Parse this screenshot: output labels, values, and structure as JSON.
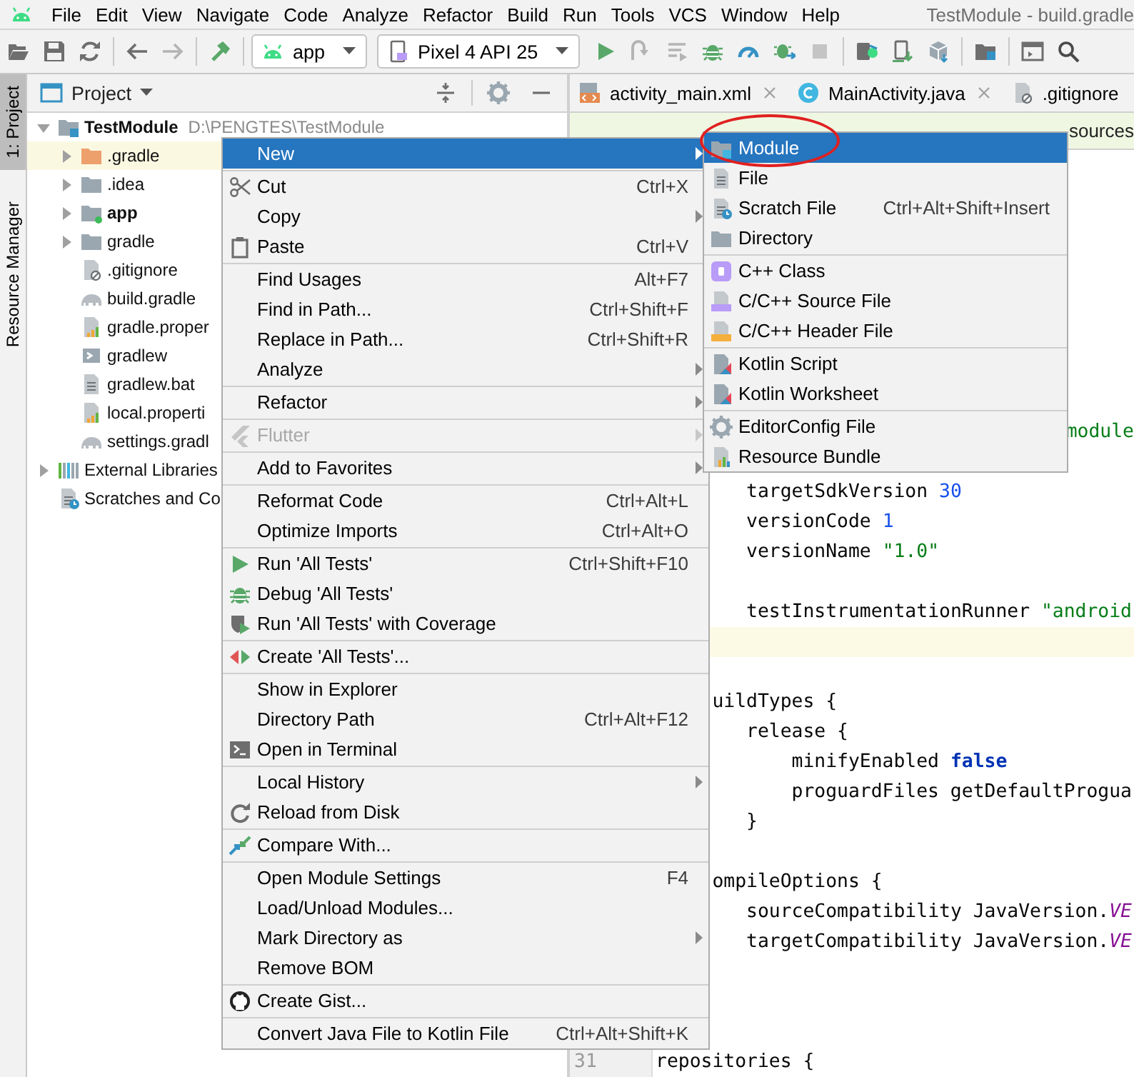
{
  "menu_bar": {
    "items": [
      "File",
      "Edit",
      "View",
      "Navigate",
      "Code",
      "Analyze",
      "Refactor",
      "Build",
      "Run",
      "Tools",
      "VCS",
      "Window",
      "Help"
    ],
    "title": "TestModule - build.gradle"
  },
  "toolbar": {
    "configuration": "app",
    "device": "Pixel 4 API 25"
  },
  "side_tabs": [
    {
      "label": "1: Project",
      "selected": true
    },
    {
      "label": "Resource Manager",
      "selected": false
    }
  ],
  "project_panel": {
    "title": "Project",
    "tree": [
      {
        "label": "TestModule",
        "path": "D:\\PENGTES\\TestModule",
        "kind": "project",
        "expanded": true,
        "children": [
          {
            "label": ".gradle",
            "kind": "folder",
            "expanded": false,
            "highlighted": true
          },
          {
            "label": ".idea",
            "kind": "folder",
            "expanded": false,
            "highlighted": false
          },
          {
            "label": "app",
            "kind": "module",
            "expanded": false,
            "highlighted": false
          },
          {
            "label": "gradle",
            "kind": "folder",
            "expanded": false,
            "highlighted": false
          },
          {
            "label": ".gitignore",
            "kind": "file",
            "highlighted": false
          },
          {
            "label": "build.gradle",
            "kind": "file",
            "highlighted": false
          },
          {
            "label": "gradle.proper",
            "kind": "file",
            "highlighted": false
          },
          {
            "label": "gradlew",
            "kind": "file",
            "highlighted": false
          },
          {
            "label": "gradlew.bat",
            "kind": "file",
            "highlighted": false
          },
          {
            "label": "local.properti",
            "kind": "file",
            "highlighted": false
          },
          {
            "label": "settings.gradl",
            "kind": "file",
            "highlighted": false
          }
        ]
      },
      {
        "label": "External Libraries",
        "kind": "libraries",
        "expanded": false
      },
      {
        "label": "Scratches and Co",
        "kind": "scratches"
      }
    ]
  },
  "editor": {
    "tabs": [
      {
        "label": "activity_main.xml",
        "closable": true
      },
      {
        "label": "MainActivity.java",
        "closable": true
      },
      {
        "label": ".gitignore",
        "closable": false
      }
    ],
    "banner": "sources",
    "lines": [
      {
        "kind": "tail",
        "current": false,
        "tokens": [
          {
            "text": "module",
            "kind": "string"
          }
        ]
      },
      {
        "kind": "blank",
        "current": false
      },
      {
        "kind": "code",
        "current": false,
        "tokens": [
          {
            "text": "        targetSdkVersion ",
            "kind": "plain"
          },
          {
            "text": "30",
            "kind": "number"
          }
        ]
      },
      {
        "kind": "code",
        "current": false,
        "tokens": [
          {
            "text": "        versionCode ",
            "kind": "plain"
          },
          {
            "text": "1",
            "kind": "number"
          }
        ]
      },
      {
        "kind": "code",
        "current": false,
        "tokens": [
          {
            "text": "        versionName ",
            "kind": "plain"
          },
          {
            "text": "\"1.0\"",
            "kind": "string"
          }
        ]
      },
      {
        "kind": "blank",
        "current": false
      },
      {
        "kind": "code",
        "current": false,
        "tokens": [
          {
            "text": "        testInstrumentationRunner ",
            "kind": "plain"
          },
          {
            "text": "\"android",
            "kind": "string"
          }
        ]
      },
      {
        "kind": "blank",
        "current": true
      },
      {
        "kind": "blank",
        "current": false
      },
      {
        "kind": "code",
        "current": false,
        "tokens": [
          {
            "text": "     uildTypes {",
            "kind": "plain"
          }
        ]
      },
      {
        "kind": "code",
        "current": false,
        "tokens": [
          {
            "text": "        release {",
            "kind": "plain"
          }
        ]
      },
      {
        "kind": "code",
        "current": false,
        "tokens": [
          {
            "text": "            minifyEnabled ",
            "kind": "plain"
          },
          {
            "text": "false",
            "kind": "keyword"
          }
        ]
      },
      {
        "kind": "code",
        "current": false,
        "tokens": [
          {
            "text": "            proguardFiles getDefaultProgua",
            "kind": "plain"
          }
        ]
      },
      {
        "kind": "code",
        "current": false,
        "tokens": [
          {
            "text": "        }",
            "kind": "plain"
          }
        ]
      },
      {
        "kind": "blank",
        "current": false
      },
      {
        "kind": "code",
        "current": false,
        "tokens": [
          {
            "text": "     ompileOptions {",
            "kind": "plain"
          }
        ]
      },
      {
        "kind": "code",
        "current": false,
        "tokens": [
          {
            "text": "        sourceCompatibility JavaVersion.",
            "kind": "plain"
          },
          {
            "text": "VE",
            "kind": "constant"
          }
        ]
      },
      {
        "kind": "code",
        "current": false,
        "tokens": [
          {
            "text": "        targetCompatibility JavaVersion.",
            "kind": "plain"
          },
          {
            "text": "VE",
            "kind": "constant"
          }
        ]
      },
      {
        "kind": "blank",
        "current": false
      },
      {
        "kind": "blank",
        "current": false
      },
      {
        "kind": "blank",
        "current": false
      },
      {
        "kind": "code",
        "current": false,
        "number": "31",
        "tokens": [
          {
            "text": "repositories {",
            "kind": "plain"
          }
        ]
      }
    ]
  },
  "context_menu": {
    "groups": [
      [
        {
          "label": "New",
          "submenu": true,
          "selected": true,
          "disabled": false
        }
      ],
      [
        {
          "label": "Cut",
          "shortcut": "Ctrl+X",
          "submenu": false,
          "selected": false,
          "disabled": false
        },
        {
          "label": "Copy",
          "submenu": true,
          "selected": false,
          "disabled": false
        },
        {
          "label": "Paste",
          "shortcut": "Ctrl+V",
          "submenu": false,
          "selected": false,
          "disabled": false
        }
      ],
      [
        {
          "label": "Find Usages",
          "shortcut": "Alt+F7",
          "submenu": false,
          "selected": false,
          "disabled": false
        },
        {
          "label": "Find in Path...",
          "shortcut": "Ctrl+Shift+F",
          "submenu": false,
          "selected": false,
          "disabled": false
        },
        {
          "label": "Replace in Path...",
          "shortcut": "Ctrl+Shift+R",
          "submenu": false,
          "selected": false,
          "disabled": false
        },
        {
          "label": "Analyze",
          "submenu": true,
          "selected": false,
          "disabled": false
        }
      ],
      [
        {
          "label": "Refactor",
          "submenu": true,
          "selected": false,
          "disabled": false
        }
      ],
      [
        {
          "label": "Flutter",
          "submenu": true,
          "selected": false,
          "disabled": true
        }
      ],
      [
        {
          "label": "Add to Favorites",
          "submenu": true,
          "selected": false,
          "disabled": false
        }
      ],
      [
        {
          "label": "Reformat Code",
          "shortcut": "Ctrl+Alt+L",
          "submenu": false,
          "selected": false,
          "disabled": false
        },
        {
          "label": "Optimize Imports",
          "shortcut": "Ctrl+Alt+O",
          "submenu": false,
          "selected": false,
          "disabled": false
        }
      ],
      [
        {
          "label": "Run 'All Tests'",
          "shortcut": "Ctrl+Shift+F10",
          "submenu": false,
          "selected": false,
          "disabled": false
        },
        {
          "label": "Debug 'All Tests'",
          "submenu": false,
          "selected": false,
          "disabled": false
        },
        {
          "label": "Run 'All Tests' with Coverage",
          "submenu": false,
          "selected": false,
          "disabled": false
        }
      ],
      [
        {
          "label": "Create 'All Tests'...",
          "submenu": false,
          "selected": false,
          "disabled": false
        }
      ],
      [
        {
          "label": "Show in Explorer",
          "submenu": false,
          "selected": false,
          "disabled": false
        },
        {
          "label": "Directory Path",
          "shortcut": "Ctrl+Alt+F12",
          "submenu": false,
          "selected": false,
          "disabled": false
        },
        {
          "label": "Open in Terminal",
          "submenu": false,
          "selected": false,
          "disabled": false
        }
      ],
      [
        {
          "label": "Local History",
          "submenu": true,
          "selected": false,
          "disabled": false
        },
        {
          "label": "Reload from Disk",
          "submenu": false,
          "selected": false,
          "disabled": false
        }
      ],
      [
        {
          "label": "Compare With...",
          "submenu": false,
          "selected": false,
          "disabled": false
        }
      ],
      [
        {
          "label": "Open Module Settings",
          "shortcut": "F4",
          "submenu": false,
          "selected": false,
          "disabled": false
        },
        {
          "label": "Load/Unload Modules...",
          "submenu": false,
          "selected": false,
          "disabled": false
        },
        {
          "label": "Mark Directory as",
          "submenu": true,
          "selected": false,
          "disabled": false
        },
        {
          "label": "Remove BOM",
          "submenu": false,
          "selected": false,
          "disabled": false
        }
      ],
      [
        {
          "label": "Create Gist...",
          "submenu": false,
          "selected": false,
          "disabled": false
        }
      ],
      [
        {
          "label": "Convert Java File to Kotlin File",
          "shortcut": "Ctrl+Alt+Shift+K",
          "submenu": false,
          "selected": false,
          "disabled": false
        }
      ]
    ]
  },
  "submenu": {
    "groups": [
      [
        {
          "label": "Module",
          "selected": true,
          "circled": true
        },
        {
          "label": "File",
          "selected": false,
          "circled": false
        },
        {
          "label": "Scratch File",
          "shortcut": "Ctrl+Alt+Shift+Insert",
          "selected": false,
          "circled": false
        },
        {
          "label": "Directory",
          "selected": false,
          "circled": false
        }
      ],
      [
        {
          "label": "C++ Class",
          "selected": false,
          "circled": false
        },
        {
          "label": "C/C++ Source File",
          "selected": false,
          "circled": false
        },
        {
          "label": "C/C++ Header File",
          "selected": false,
          "circled": false
        }
      ],
      [
        {
          "label": "Kotlin Script",
          "selected": false,
          "circled": false
        },
        {
          "label": "Kotlin Worksheet",
          "selected": false,
          "circled": false
        }
      ],
      [
        {
          "label": "EditorConfig File",
          "selected": false,
          "circled": false
        },
        {
          "label": "Resource Bundle",
          "selected": false,
          "circled": false
        }
      ]
    ]
  }
}
